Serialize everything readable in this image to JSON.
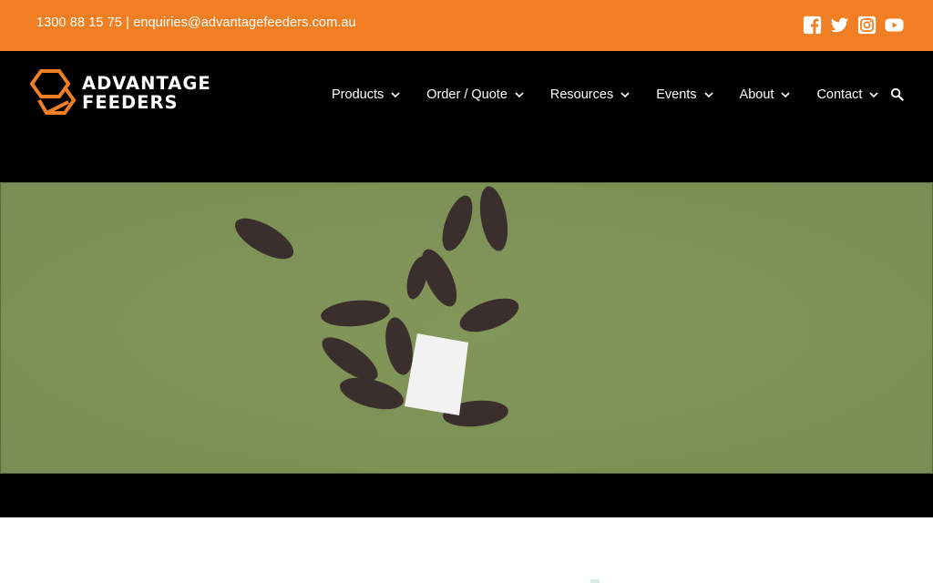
{
  "topbar": {
    "phone": "1300 88 15 75",
    "separator": "|",
    "email": "enquiries@advantagefeeders.com.au",
    "social": [
      "facebook-icon",
      "twitter-icon",
      "instagram-icon",
      "youtube-icon"
    ],
    "background": "#f07f23"
  },
  "brand": {
    "line1": "ADVANTAGE",
    "line2": "FEEDERS",
    "accent": "#f07f23"
  },
  "nav": {
    "items": [
      {
        "label": "Products"
      },
      {
        "label": "Order / Quote"
      },
      {
        "label": "Resources"
      },
      {
        "label": "Events"
      },
      {
        "label": "About"
      },
      {
        "label": "Contact"
      }
    ],
    "search_icon": "search-icon"
  },
  "hero": {
    "type": "video",
    "subject": "aerial view of cattle around a feeder in a grass paddock"
  }
}
